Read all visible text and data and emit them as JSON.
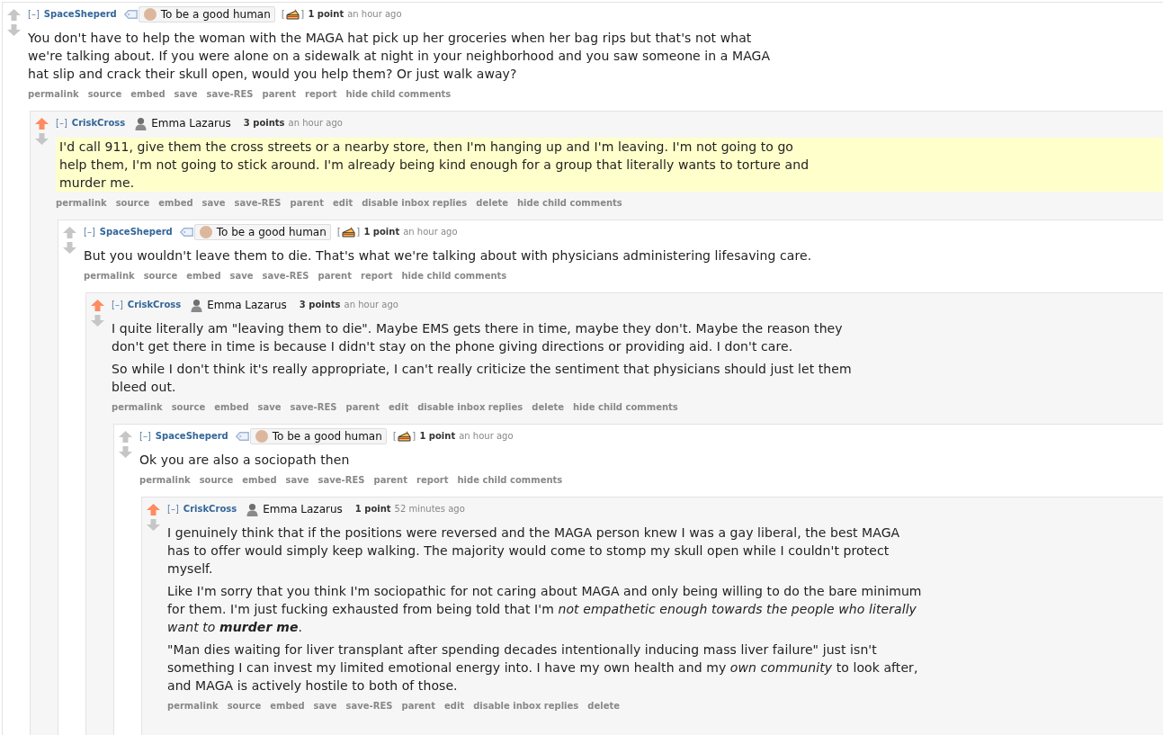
{
  "comments": [
    {
      "toggle": "[–]",
      "author": "SpaceSheperd",
      "upvoted": false,
      "user_tag": true,
      "flair": {
        "text": "To be a good human",
        "kind": "boxed"
      },
      "cake_badge": {
        "open": "[",
        "close": "]"
      },
      "points": "1 point",
      "time": "an hour ago",
      "highlighted": false,
      "body": [
        "You don't have to help the woman with the MAGA hat pick up her groceries when her bag rips but that's not what we're talking about. If you were alone on a sidewalk at night in your neighborhood and you saw someone in a MAGA hat slip and crack their skull open, would you help them? Or just walk away?"
      ],
      "actions": [
        "permalink",
        "source",
        "embed",
        "save",
        "save-RES",
        "parent",
        "report",
        "hide child comments"
      ],
      "children": [
        {
          "toggle": "[–]",
          "author": "CriskCross",
          "upvoted": true,
          "user_tag": false,
          "flair": {
            "text": "Emma Lazarus",
            "kind": "plain"
          },
          "points": "3 points",
          "time": "an hour ago",
          "highlighted": true,
          "body": [
            "I'd call 911, give them the cross streets or a nearby store, then I'm hanging up and I'm leaving. I'm not going to go help them, I'm not going to stick around. I'm already being kind enough for a group that literally wants to torture and murder me."
          ],
          "actions": [
            "permalink",
            "source",
            "embed",
            "save",
            "save-RES",
            "parent",
            "edit",
            "disable inbox replies",
            "delete",
            "hide child comments"
          ],
          "children": [
            {
              "toggle": "[–]",
              "author": "SpaceSheperd",
              "upvoted": false,
              "user_tag": true,
              "flair": {
                "text": "To be a good human",
                "kind": "boxed"
              },
              "cake_badge": {
                "open": "[",
                "close": "]"
              },
              "points": "1 point",
              "time": "an hour ago",
              "highlighted": false,
              "body": [
                "But you wouldn't leave them to die. That's what we're talking about with physicians administering lifesaving care."
              ],
              "actions": [
                "permalink",
                "source",
                "embed",
                "save",
                "save-RES",
                "parent",
                "report",
                "hide child comments"
              ],
              "children": [
                {
                  "toggle": "[–]",
                  "author": "CriskCross",
                  "upvoted": true,
                  "user_tag": false,
                  "flair": {
                    "text": "Emma Lazarus",
                    "kind": "plain"
                  },
                  "points": "3 points",
                  "time": "an hour ago",
                  "highlighted": false,
                  "body": [
                    "I quite literally am \"leaving them to die\". Maybe EMS gets there in time, maybe they don't. Maybe the reason they don't get there in time is because I didn't stay on the phone giving directions or providing aid. I don't care.",
                    "So while I don't think it's really appropriate, I can't really criticize the sentiment that physicians should just let them bleed out."
                  ],
                  "actions": [
                    "permalink",
                    "source",
                    "embed",
                    "save",
                    "save-RES",
                    "parent",
                    "edit",
                    "disable inbox replies",
                    "delete",
                    "hide child comments"
                  ],
                  "children": [
                    {
                      "toggle": "[–]",
                      "author": "SpaceSheperd",
                      "upvoted": false,
                      "user_tag": true,
                      "flair": {
                        "text": "To be a good human",
                        "kind": "boxed"
                      },
                      "cake_badge": {
                        "open": "[",
                        "close": "]"
                      },
                      "points": "1 point",
                      "time": "an hour ago",
                      "highlighted": false,
                      "body": [
                        "Ok you are also a sociopath then"
                      ],
                      "actions": [
                        "permalink",
                        "source",
                        "embed",
                        "save",
                        "save-RES",
                        "parent",
                        "report",
                        "hide child comments"
                      ],
                      "children": [
                        {
                          "toggle": "[–]",
                          "author": "CriskCross",
                          "upvoted": true,
                          "user_tag": false,
                          "flair": {
                            "text": "Emma Lazarus",
                            "kind": "plain"
                          },
                          "points": "1 point",
                          "time": "52 minutes ago",
                          "highlighted": false,
                          "body": [
                            "I genuinely think that if the positions were reversed and the MAGA person knew I was a gay liberal, the best MAGA has to offer would simply keep walking. The majority would come to stomp my skull open while I couldn't protect myself.",
                            "Like I'm sorry that you think I'm sociopathic for not caring about MAGA and only being willing to do the bare minimum for them. I'm just fucking exhausted from being told that I'm *not empathetic enough towards the people who literally want to* **murder me**.",
                            "\"Man dies waiting for liver transplant after spending decades intentionally inducing mass liver failure\" just isn't something I can invest my limited emotional energy into. I have my own health and my *own community* to look after, and MAGA is actively hostile to both of those."
                          ],
                          "actions": [
                            "permalink",
                            "source",
                            "embed",
                            "save",
                            "save-RES",
                            "parent",
                            "edit",
                            "disable inbox replies",
                            "delete"
                          ]
                        }
                      ]
                    }
                  ]
                }
              ]
            }
          ]
        }
      ]
    }
  ]
}
